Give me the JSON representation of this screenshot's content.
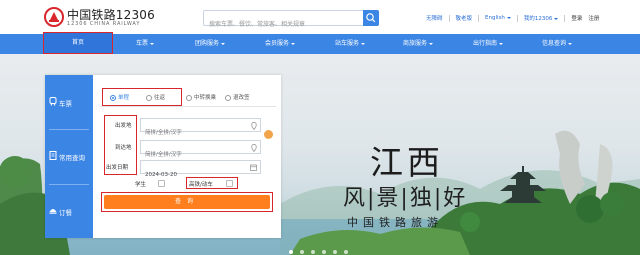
{
  "header": {
    "logo_cn": "中国铁路12306",
    "logo_en": "12306 CHINA RAILWAY",
    "search_placeholder": "搜索车票、餐饮、常旅客、相关规章",
    "links": {
      "accessible": "无障碍",
      "care": "敬老版",
      "language": "English",
      "my12306": "我的12306",
      "login": "登录",
      "register": "注册"
    }
  },
  "nav": {
    "items": [
      {
        "label": "首页",
        "has_caret": false
      },
      {
        "label": "车票",
        "has_caret": true
      },
      {
        "label": "团购服务",
        "has_caret": true
      },
      {
        "label": "会员服务",
        "has_caret": true
      },
      {
        "label": "站车服务",
        "has_caret": true
      },
      {
        "label": "商旅服务",
        "has_caret": true
      },
      {
        "label": "出行指南",
        "has_caret": true
      },
      {
        "label": "信息查询",
        "has_caret": true
      }
    ]
  },
  "booking": {
    "side_tabs": [
      {
        "label": "车票",
        "icon": "train-icon"
      },
      {
        "label": "常用查询",
        "icon": "document-icon"
      },
      {
        "label": "订餐",
        "icon": "meal-icon"
      }
    ],
    "trip_types": [
      {
        "label": "单程",
        "selected": true
      },
      {
        "label": "往返",
        "selected": false
      },
      {
        "label": "中转换乘",
        "selected": false
      },
      {
        "label": "退改签",
        "selected": false
      }
    ],
    "from_label": "出发地",
    "from_placeholder": "简拼/全拼/汉字",
    "to_label": "到达地",
    "to_placeholder": "简拼/全拼/汉字",
    "date_label": "出发日期",
    "date_value": "2024-03-20",
    "student_label": "学生",
    "highspeed_label": "高铁/动车",
    "query_label": "查询"
  },
  "banner": {
    "line1": "江西",
    "line2": "风|景|独|好",
    "line3": "中国铁路旅游",
    "slide_count": 6,
    "active_slide": 0
  },
  "colors": {
    "brand_blue": "#3b85e5",
    "query_orange": "#ff7e1d",
    "highlight_red": "#d8262d"
  }
}
